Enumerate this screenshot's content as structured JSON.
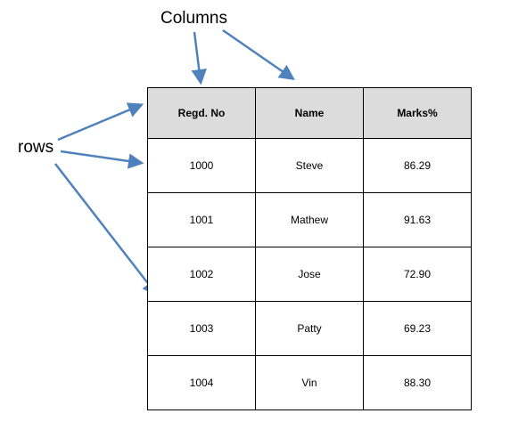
{
  "labels": {
    "columns": "Columns",
    "rows": "rows"
  },
  "table": {
    "headers": [
      "Regd. No",
      "Name",
      "Marks%"
    ],
    "rows": [
      {
        "regd": "1000",
        "name": "Steve",
        "marks": "86.29"
      },
      {
        "regd": "1001",
        "name": "Mathew",
        "marks": "91.63"
      },
      {
        "regd": "1002",
        "name": "Jose",
        "marks": "72.90"
      },
      {
        "regd": "1003",
        "name": "Patty",
        "marks": "69.23"
      },
      {
        "regd": "1004",
        "name": "Vin",
        "marks": "88.30"
      }
    ]
  }
}
